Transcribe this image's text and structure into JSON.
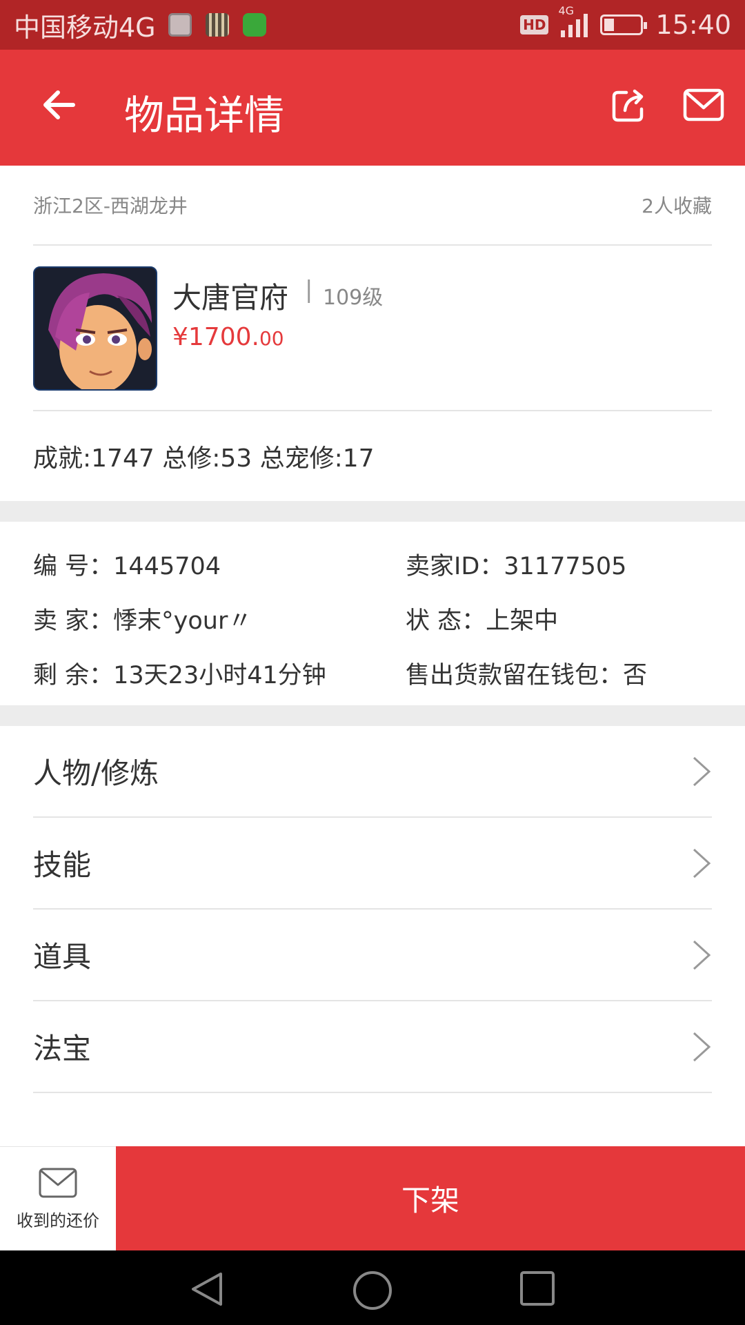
{
  "status_bar": {
    "carrier": "中国移动4G",
    "hd_badge": "HD",
    "network": "4G",
    "time": "15:40"
  },
  "app_bar": {
    "title": "物品详情"
  },
  "listing": {
    "server": "浙江2区-西湖龙井",
    "favorites": "2人收藏",
    "name": "大唐官府",
    "separator": "|",
    "level": "109级",
    "price_main": "¥1700.",
    "price_cents": "00",
    "stats": "成就:1747 总修:53 总宠修:17"
  },
  "details": {
    "id_label": "编  号：",
    "id_value": "1445704",
    "seller_id_label": "卖家ID：",
    "seller_id_value": "31177505",
    "seller_label": "卖  家：",
    "seller_value": "悸末°your〃",
    "status_label": "状  态：",
    "status_value": "上架中",
    "remaining_label": "剩  余：",
    "remaining_value": "13天23小时41分钟",
    "wallet_label": "售出货款留在钱包：",
    "wallet_value": "否"
  },
  "menu": {
    "items": [
      {
        "label": "人物/修炼"
      },
      {
        "label": "技能"
      },
      {
        "label": "道具"
      },
      {
        "label": "法宝"
      }
    ]
  },
  "bottom": {
    "offers_label": "收到的还价",
    "delist_label": "下架"
  },
  "colors": {
    "brand_red": "#e5383b",
    "status_bar": "#b12526",
    "price_red": "#e53a3c"
  }
}
